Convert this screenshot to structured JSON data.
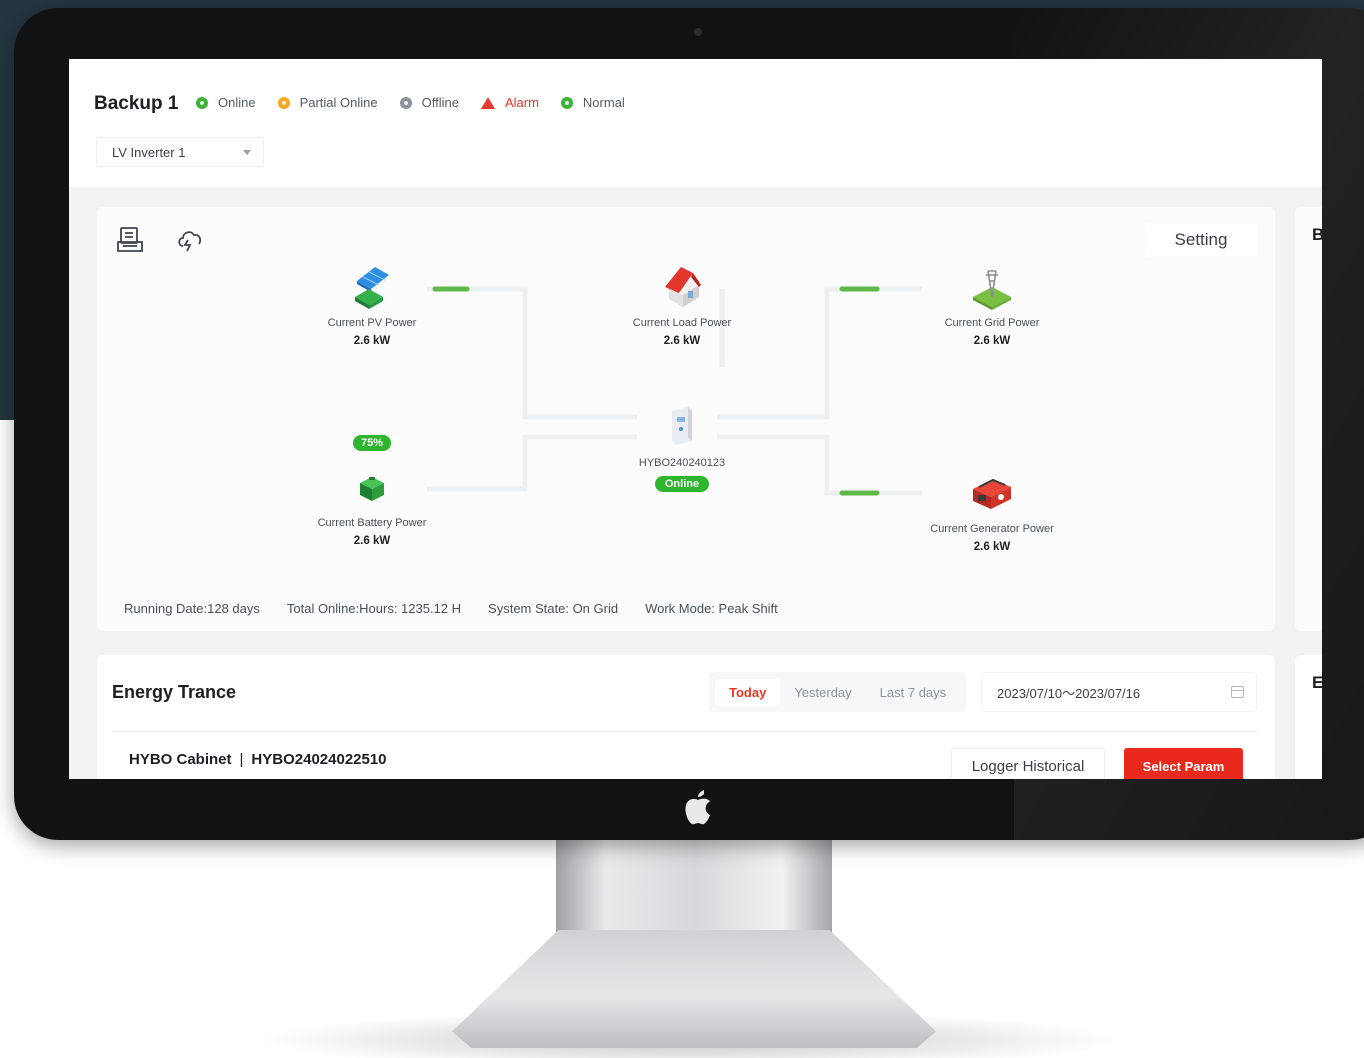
{
  "header": {
    "title": "Backup 1",
    "legend": [
      {
        "label": "Online",
        "color": "#3bb33b",
        "icon": "online-dot-icon"
      },
      {
        "label": "Partial Online",
        "color": "#f5a623",
        "icon": "partial-online-dot-icon"
      },
      {
        "label": "Offline",
        "color": "#8e9299",
        "icon": "offline-dot-icon"
      },
      {
        "label": "Alarm",
        "color": "#e63a2e",
        "icon": "alarm-triangle-icon"
      },
      {
        "label": "Normal",
        "color": "#3bb33b",
        "icon": "normal-dot-icon"
      }
    ],
    "device_select": {
      "value": "LV Inverter 1",
      "icon": "chevron-down-icon"
    }
  },
  "flow_panel": {
    "toolbar_icons": [
      "report-icon",
      "cloud-sync-icon"
    ],
    "setting_label": "Setting",
    "nodes": {
      "pv": {
        "label": "Current PV Power",
        "value": "2.6 kW",
        "icon": "solar-panel-icon"
      },
      "load": {
        "label": "Current Load Power",
        "value": "2.6 kW",
        "icon": "house-icon"
      },
      "grid": {
        "label": "Current Grid Power",
        "value": "2.6 kW",
        "icon": "grid-tower-icon"
      },
      "battery": {
        "label": "Current Battery Power",
        "value": "2.6 kW",
        "soc": "75%",
        "icon": "battery-icon"
      },
      "inverter": {
        "label": "HYBO240240123",
        "status": "Online",
        "icon": "inverter-icon"
      },
      "generator": {
        "label": "Current Generator Power",
        "value": "2.6 kW",
        "icon": "generator-icon"
      }
    },
    "stats": {
      "running_date": "Running Date:128 days",
      "total_online": "Total Online:Hours: 1235.12 H",
      "system_state": "System State: On Grid",
      "work_mode": "Work Mode: Peak Shift"
    }
  },
  "side_panels": {
    "top_letter": "B",
    "bottom_letter": "E"
  },
  "energy": {
    "title": "Energy Trance",
    "tabs": [
      {
        "label": "Today",
        "active": true
      },
      {
        "label": "Yesterday",
        "active": false
      },
      {
        "label": "Last 7 days",
        "active": false
      }
    ],
    "date_range": "2023/07/10～2023/07/16",
    "cabinet_name": "HYBO Cabinet",
    "cabinet_separator": "|",
    "cabinet_id": "HYBO24024022510",
    "logger_button": "Logger Historical",
    "select_param_button": "Select Param"
  },
  "colors": {
    "accent_red": "#e8291c",
    "online_green": "#2eb52e",
    "flow_green": "#4caf3a"
  }
}
